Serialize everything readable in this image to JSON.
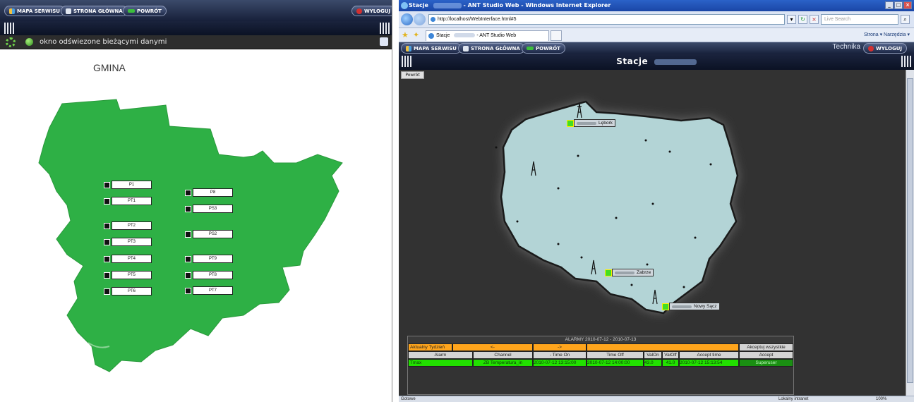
{
  "left_panel": {
    "nav": {
      "map_label": "MAPA SERWISU",
      "home_label": "STRONA GŁÓWNA",
      "back_label": "POWRÓT",
      "logout_label": "WYLOGUJ"
    },
    "status_text": "okno odświezone bieżącymi danymi",
    "map_title": "GMINA",
    "map_color": "#2eb045",
    "points": {
      "p1": "P1",
      "pt1": "PT1",
      "pt2": "PT2",
      "pt3": "PT3",
      "pt4": "PT4",
      "pt5": "PT5",
      "pt6": "PT6",
      "p8": "P8",
      "ps3": "PS3",
      "ps2": "PS2",
      "pt9": "PT9",
      "pt8": "PT8",
      "pt7": "PT7"
    }
  },
  "browser": {
    "window_title_prefix": "Stacje",
    "window_title_suffix": "- ANT Studio Web - Windows Internet Explorer",
    "url": "http://localhost/WebInterface.html#5",
    "search_placeholder": "Live Search",
    "tab_title_prefix": "Stacje",
    "tab_title_suffix": "- ANT Studio Web",
    "command_bar": "Strona ▾  Narzędzia ▾",
    "status_left": "Gotowe",
    "zone": "Lokalny intranet",
    "zoom": "100%"
  },
  "right_panel": {
    "nav": {
      "map_label": "MAPA SERWISU",
      "home_label": "STRONA GŁÓWNA",
      "back_label": "POWRÓT",
      "logout_label": "WYLOGUJ",
      "user": "Technika"
    },
    "page_title": "Stacje",
    "back_small": "Powrót",
    "map_color": "#b3d4d6",
    "stations": {
      "lebork": "Lębork",
      "zabrze": "Zabrze",
      "nowy_sacz": "Nowy Sącz"
    },
    "alarms": {
      "title": "ALARMY 2010-07-12 - 2010-07-13",
      "week": "Aktualny Tydzień",
      "prev": "<-",
      "next": "->",
      "accept_all": "Akceptuj wszystkie",
      "headers": [
        "Alarm",
        "Channel",
        "- Time On",
        "Time Off",
        "ValOn",
        "ValOff",
        "Accept time",
        "Accept"
      ],
      "row": [
        "Tmax",
        "ZB Temperatura_in",
        "2010-07-12 13:15:00",
        "2010-07-12 14:00:00",
        "43.0",
        "41.0",
        "2010-07-12 15:13:54",
        "Superuser"
      ]
    }
  }
}
